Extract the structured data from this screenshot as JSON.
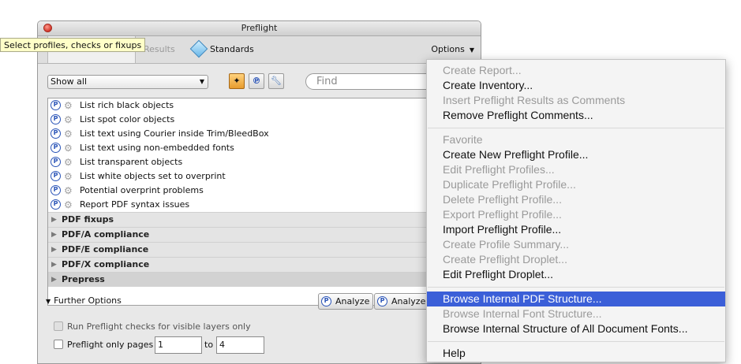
{
  "window": {
    "title": "Preflight"
  },
  "tabs": {
    "results": "Results",
    "standards": "Standards",
    "options": "Options"
  },
  "tooltip": "Select profiles, checks or fixups",
  "filter": {
    "show": "Show all",
    "find_placeholder": "Find"
  },
  "checks": [
    "List rich black objects",
    "List spot color objects",
    "List text using Courier inside Trim/BleedBox",
    "List text using non-embedded fonts",
    "List transparent objects",
    "List white objects set to overprint",
    "Potential overprint problems",
    "Report PDF syntax issues"
  ],
  "groups": [
    "PDF fixups",
    "PDF/A compliance",
    "PDF/E compliance",
    "PDF/X compliance",
    "Prepress"
  ],
  "further_options": "Further Options",
  "analyze": {
    "label1": "Analyze",
    "label2": "Analyze"
  },
  "options": {
    "visible_layers": "Run Preflight checks for visible layers only",
    "only_pages": "Preflight only pages",
    "from_page": "1",
    "to_label": "to",
    "to_page": "4"
  },
  "menu": {
    "items": [
      {
        "label": "Create Report...",
        "enabled": false
      },
      {
        "label": "Create Inventory...",
        "enabled": true
      },
      {
        "label": "Insert Preflight Results as Comments",
        "enabled": false
      },
      {
        "label": "Remove Preflight Comments...",
        "enabled": true
      },
      {
        "label": "Favorite",
        "enabled": false
      },
      {
        "label": "Create New Preflight Profile...",
        "enabled": true
      },
      {
        "label": "Edit Preflight Profiles...",
        "enabled": false
      },
      {
        "label": "Duplicate Preflight Profile...",
        "enabled": false
      },
      {
        "label": "Delete Preflight Profile...",
        "enabled": false
      },
      {
        "label": "Export Preflight Profile...",
        "enabled": false
      },
      {
        "label": "Import Preflight Profile...",
        "enabled": true
      },
      {
        "label": "Create Profile Summary...",
        "enabled": false
      },
      {
        "label": "Create Preflight Droplet...",
        "enabled": false
      },
      {
        "label": "Edit Preflight Droplet...",
        "enabled": true
      },
      {
        "label": "Browse Internal PDF Structure...",
        "enabled": true,
        "highlighted": true
      },
      {
        "label": "Browse Internal Font Structure...",
        "enabled": false
      },
      {
        "label": "Browse Internal Structure of All Document Fonts...",
        "enabled": true
      },
      {
        "label": "Help",
        "enabled": true
      }
    ]
  },
  "colors": {
    "highlight": "#3b5fd8",
    "tooltip_bg": "#ffffc8",
    "disabled_text": "#9a9a9a"
  }
}
